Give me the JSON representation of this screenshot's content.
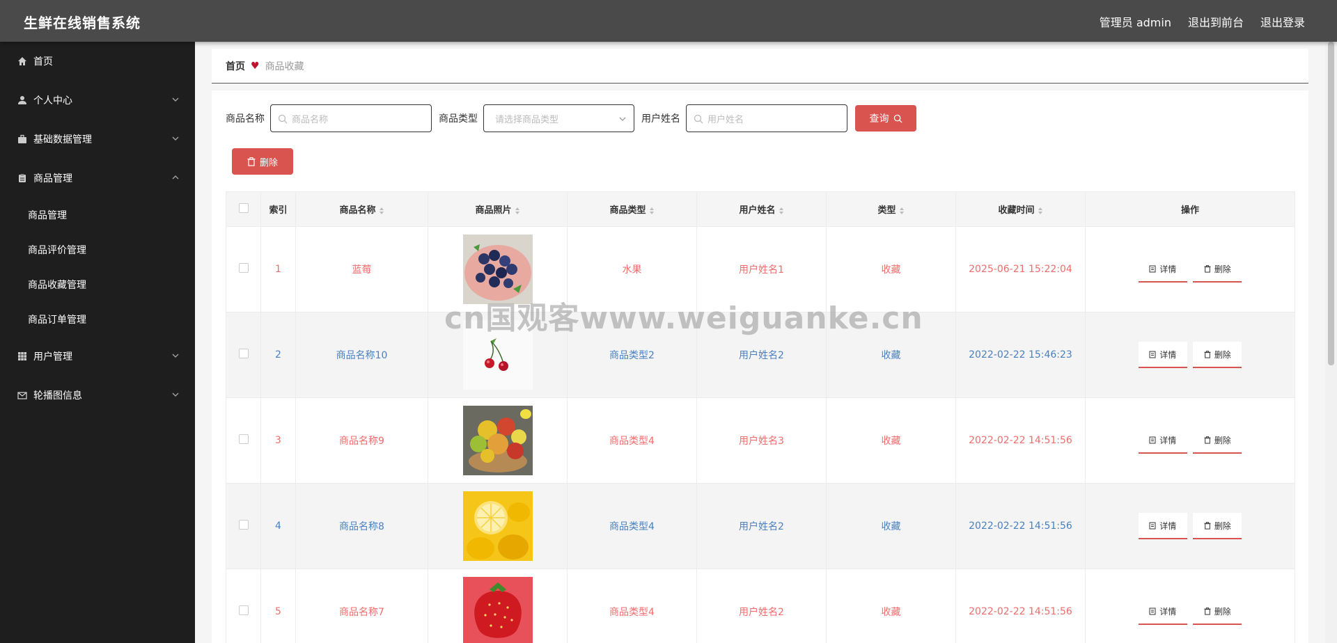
{
  "header": {
    "app_title": "生鲜在线销售系统",
    "admin_label": "管理员 admin",
    "to_front_label": "退出到前台",
    "logout_label": "退出登录"
  },
  "sidebar": {
    "items": [
      {
        "label": "首页",
        "icon": "home-icon"
      },
      {
        "label": "个人中心",
        "icon": "user-icon"
      },
      {
        "label": "基础数据管理",
        "icon": "briefcase-icon"
      },
      {
        "label": "商品管理",
        "icon": "clipboard-icon"
      },
      {
        "label": "用户管理",
        "icon": "grid-icon"
      },
      {
        "label": "轮播图信息",
        "icon": "mail-icon"
      }
    ],
    "sub_items": [
      "商品管理",
      "商品评价管理",
      "商品收藏管理",
      "商品订单管理"
    ]
  },
  "breadcrumb": {
    "home": "首页",
    "current": "商品收藏"
  },
  "search": {
    "name_label": "商品名称",
    "name_placeholder": "商品名称",
    "type_label": "商品类型",
    "type_placeholder": "请选择商品类型",
    "user_label": "用户姓名",
    "user_placeholder": "用户姓名",
    "query_label": "查询"
  },
  "actions": {
    "delete_label": "删除"
  },
  "table": {
    "headers": [
      "索引",
      "商品名称",
      "商品照片",
      "商品类型",
      "用户姓名",
      "类型",
      "收藏时间",
      "操作"
    ],
    "rows": [
      {
        "index": "1",
        "name": "蓝莓",
        "type": "水果",
        "user": "用户姓名1",
        "kind": "收藏",
        "time": "2025-06-21 15:22:04"
      },
      {
        "index": "2",
        "name": "商品名称10",
        "type": "商品类型2",
        "user": "用户姓名2",
        "kind": "收藏",
        "time": "2022-02-22 15:46:23"
      },
      {
        "index": "3",
        "name": "商品名称9",
        "type": "商品类型4",
        "user": "用户姓名3",
        "kind": "收藏",
        "time": "2022-02-22 14:51:56"
      },
      {
        "index": "4",
        "name": "商品名称8",
        "type": "商品类型4",
        "user": "用户姓名2",
        "kind": "收藏",
        "time": "2022-02-22 14:51:56"
      },
      {
        "index": "5",
        "name": "商品名称7",
        "type": "商品类型4",
        "user": "用户姓名2",
        "kind": "收藏",
        "time": "2022-02-22 14:51:56"
      }
    ],
    "detail_label": "详情",
    "delete_label": "删除"
  },
  "watermark": "cn国观客www.weiguanke.cn",
  "colors": {
    "accent": "#d9534f",
    "odd_row_text": "#f06c6c",
    "even_row_text": "#4a80c0",
    "sidebar_bg": "#1e1e1e",
    "header_bg": "#4a4a4a"
  }
}
